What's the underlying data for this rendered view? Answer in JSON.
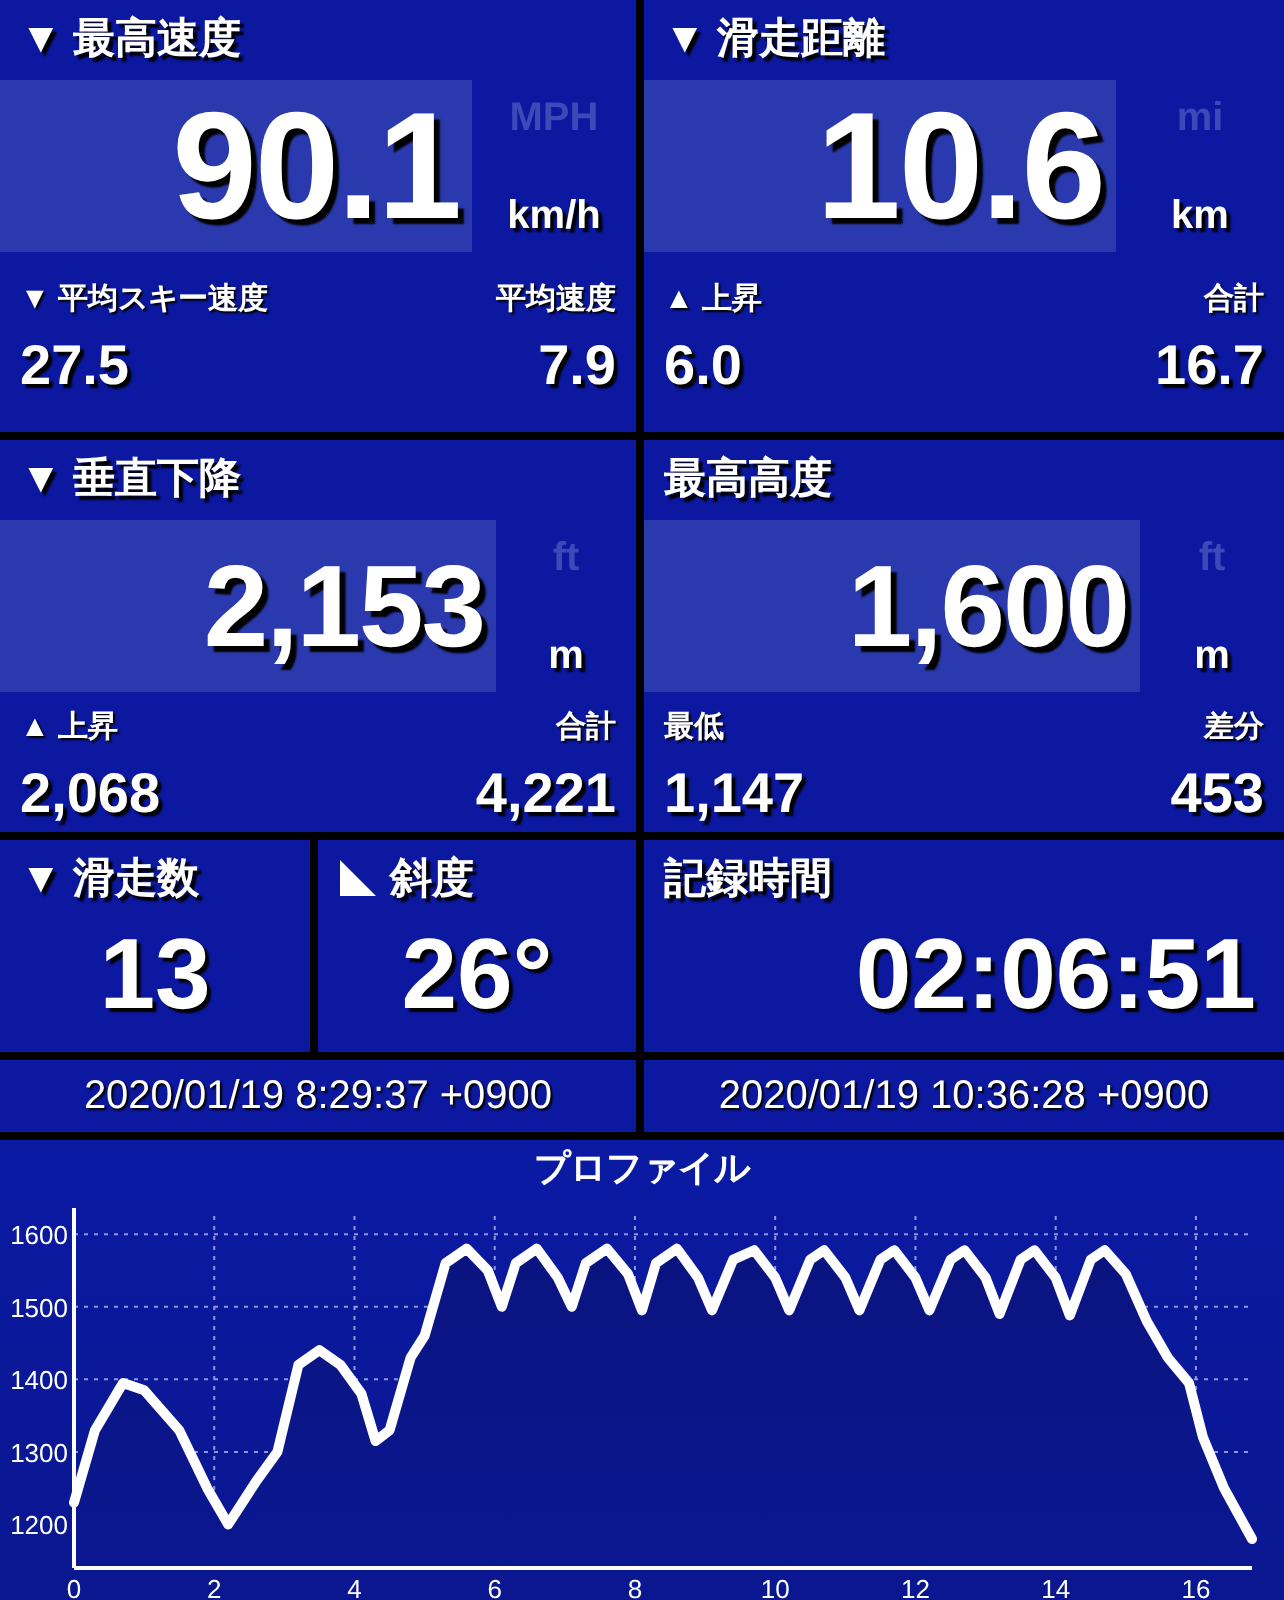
{
  "metric_panels": [
    {
      "title": "▼ 最高速度",
      "value": "90.1",
      "units": [
        {
          "label": "MPH",
          "selected": false
        },
        {
          "label": "km/h",
          "selected": true
        }
      ],
      "stats": [
        {
          "label": "▼ 平均スキー速度",
          "value": "27.5"
        },
        {
          "label": "平均速度",
          "value": "7.9"
        }
      ]
    },
    {
      "title": "▼ 滑走距離",
      "value": "10.6",
      "units": [
        {
          "label": "mi",
          "selected": false
        },
        {
          "label": "km",
          "selected": true
        }
      ],
      "stats": [
        {
          "label": "▲ 上昇",
          "value": "6.0"
        },
        {
          "label": "合計",
          "value": "16.7"
        }
      ]
    },
    {
      "title": "▼ 垂直下降",
      "value": "2,153",
      "units": [
        {
          "label": "ft",
          "selected": false
        },
        {
          "label": "m",
          "selected": true
        }
      ],
      "stats": [
        {
          "label": "▲ 上昇",
          "value": "2,068"
        },
        {
          "label": "合計",
          "value": "4,221"
        }
      ]
    },
    {
      "title": "最高高度",
      "value": "1,600",
      "units": [
        {
          "label": "ft",
          "selected": false
        },
        {
          "label": "m",
          "selected": true
        }
      ],
      "stats": [
        {
          "label": "最低",
          "value": "1,147"
        },
        {
          "label": "差分",
          "value": "453"
        }
      ]
    }
  ],
  "small_panels": [
    {
      "kind": "runs",
      "title": "▼ 滑走数",
      "value": "13"
    },
    {
      "kind": "slope",
      "title": "斜度",
      "value": "26°"
    }
  ],
  "duration_panel": {
    "title": "記録時間",
    "value": "02:06:51"
  },
  "timestamps": [
    "2020/01/19 8:29:37 +0900",
    "2020/01/19 10:36:28 +0900"
  ],
  "profile": {
    "chart_data": {
      "type": "area",
      "title": "プロファイル",
      "x": [
        0,
        0.3,
        0.7,
        1.0,
        1.5,
        1.9,
        2.2,
        2.6,
        2.9,
        3.2,
        3.5,
        3.8,
        4.1,
        4.3,
        4.5,
        4.8,
        5.0,
        5.3,
        5.6,
        5.9,
        6.1,
        6.3,
        6.6,
        6.9,
        7.1,
        7.3,
        7.6,
        7.9,
        8.1,
        8.3,
        8.6,
        8.9,
        9.1,
        9.4,
        9.7,
        10.0,
        10.2,
        10.5,
        10.7,
        11.0,
        11.2,
        11.5,
        11.7,
        12.0,
        12.2,
        12.5,
        12.7,
        13.0,
        13.2,
        13.5,
        13.7,
        14.0,
        14.2,
        14.5,
        14.7,
        15.0,
        15.3,
        15.6,
        15.9,
        16.1,
        16.4,
        16.8
      ],
      "series": [
        {
          "color": "#ffffff",
          "values": [
            1230,
            1330,
            1395,
            1385,
            1330,
            1250,
            1200,
            1260,
            1300,
            1420,
            1440,
            1420,
            1380,
            1315,
            1330,
            1430,
            1460,
            1560,
            1580,
            1550,
            1500,
            1560,
            1580,
            1540,
            1500,
            1560,
            1580,
            1545,
            1495,
            1560,
            1580,
            1540,
            1495,
            1565,
            1578,
            1540,
            1495,
            1565,
            1578,
            1540,
            1495,
            1565,
            1578,
            1540,
            1495,
            1565,
            1578,
            1540,
            1490,
            1565,
            1578,
            1540,
            1488,
            1565,
            1578,
            1545,
            1480,
            1430,
            1395,
            1320,
            1250,
            1180
          ]
        }
      ],
      "grid": true,
      "xlim": [
        0,
        16.8
      ],
      "ylim": [
        1140,
        1625
      ],
      "xticks": [
        0,
        2,
        4,
        6,
        8,
        10,
        12,
        14,
        16
      ],
      "yticks": [
        1200,
        1300,
        1400,
        1500,
        1600
      ]
    }
  }
}
